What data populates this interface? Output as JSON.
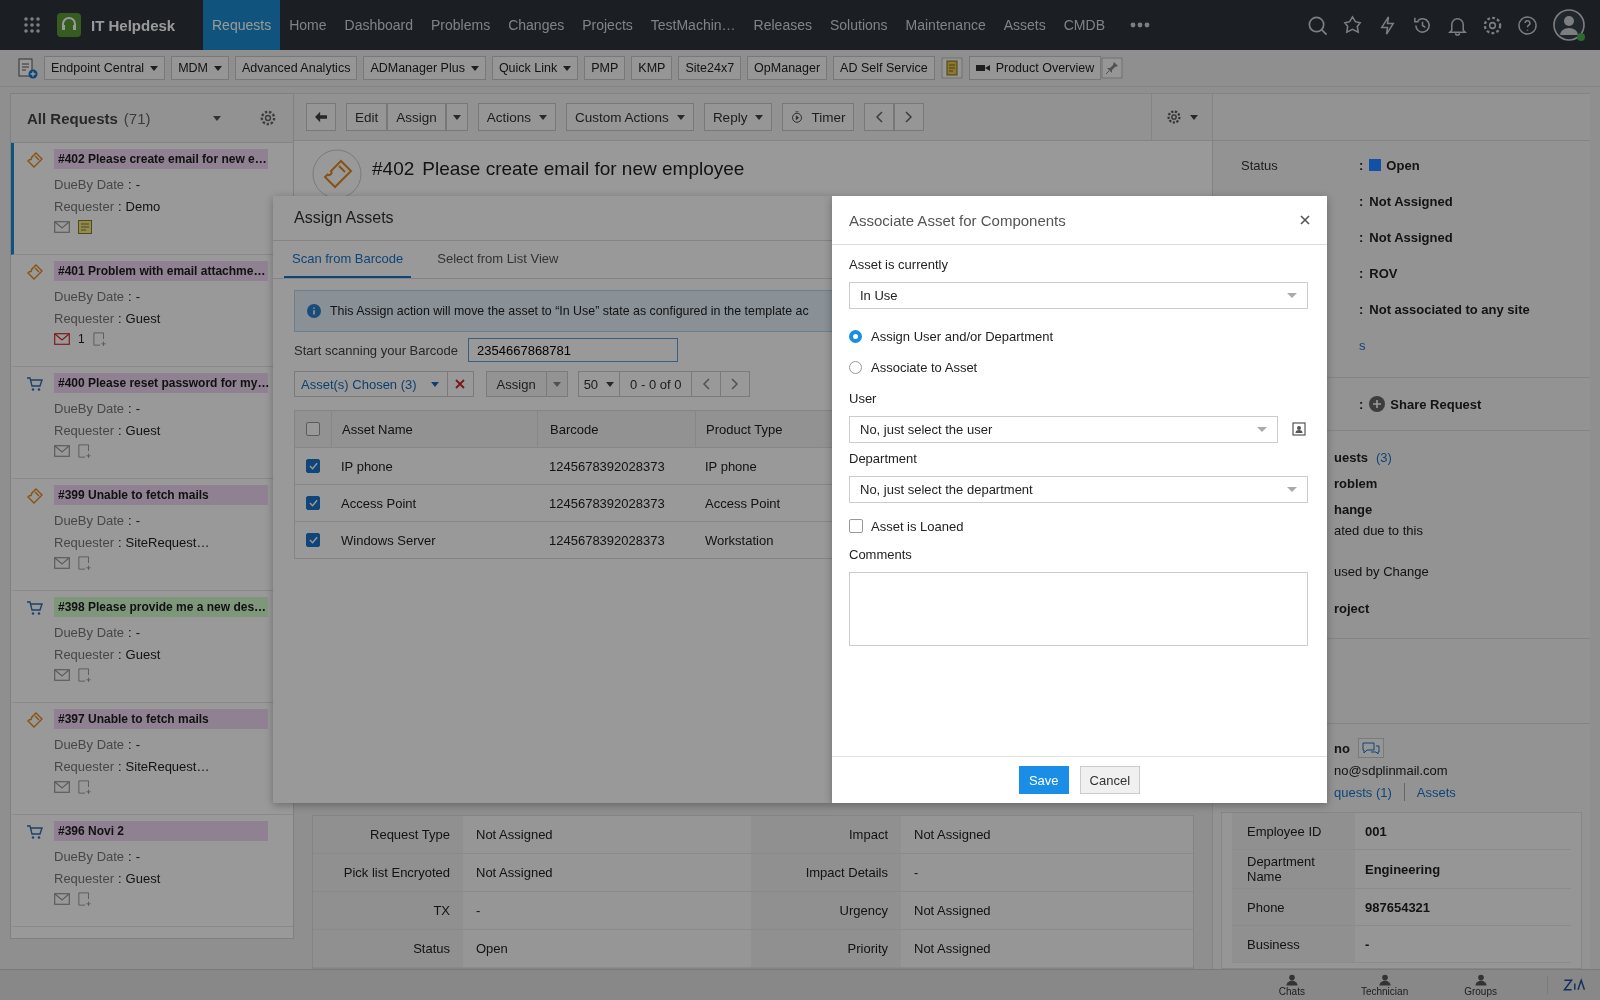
{
  "app": {
    "title": "IT Helpdesk"
  },
  "nav": [
    {
      "label": "Requests",
      "selected": true
    },
    {
      "label": "Home",
      "selected": false
    },
    {
      "label": "Dashboard",
      "selected": false
    },
    {
      "label": "Problems",
      "selected": false
    },
    {
      "label": "Changes",
      "selected": false
    },
    {
      "label": "Projects",
      "selected": false
    },
    {
      "label": "TestMachin…",
      "selected": false
    },
    {
      "label": "Releases",
      "selected": false
    },
    {
      "label": "Solutions",
      "selected": false
    },
    {
      "label": "Maintenance",
      "selected": false
    },
    {
      "label": "Assets",
      "selected": false
    },
    {
      "label": "CMDB",
      "selected": false
    }
  ],
  "quick_links": [
    {
      "label": "Endpoint Central",
      "dropdown": true
    },
    {
      "label": "MDM",
      "dropdown": true
    },
    {
      "label": "Advanced Analytics",
      "dropdown": false
    },
    {
      "label": "ADManager Plus",
      "dropdown": true
    },
    {
      "label": "Quick Link",
      "dropdown": true
    },
    {
      "label": "PMP",
      "dropdown": false
    },
    {
      "label": "KMP",
      "dropdown": false
    },
    {
      "label": "Site24x7",
      "dropdown": false
    },
    {
      "label": "OpManager",
      "dropdown": false
    },
    {
      "label": "AD Self Service",
      "dropdown": false
    }
  ],
  "product_overview": "Product Overview",
  "request_list": {
    "title": "All Requests",
    "count": "(71)",
    "separator": ":",
    "items": [
      {
        "kind": "incident",
        "title": "#402 Please create email for new e…",
        "color": "#8f8092",
        "selected": true,
        "dueby_label": "DueBy Date",
        "dueby": "-",
        "requester_label": "Requester",
        "requester": "Demo",
        "mail_unread": false,
        "note": true
      },
      {
        "kind": "incident",
        "title": "#401 Problem with email attachme…",
        "color": "#8f8092",
        "selected": false,
        "dueby_label": "DueBy Date",
        "dueby": "-",
        "requester_label": "Requester",
        "requester": "Guest",
        "mail_unread": true,
        "mail_count": "1",
        "note": false
      },
      {
        "kind": "service",
        "title": "#400 Please reset password for my…",
        "color": "#8f8092",
        "selected": false,
        "dueby_label": "DueBy Date",
        "dueby": "-",
        "requester_label": "Requester",
        "requester": "Guest",
        "mail_unread": false,
        "note": false
      },
      {
        "kind": "incident",
        "title": "#399 Unable to fetch mails",
        "color": "#8f8092",
        "selected": false,
        "dueby_label": "DueBy Date",
        "dueby": "-",
        "requester_label": "Requester",
        "requester": "SiteRequest…",
        "mail_unread": false,
        "note": false
      },
      {
        "kind": "service",
        "title": "#398 Please provide me a new des…",
        "color": "#7e977b",
        "selected": false,
        "dueby_label": "DueBy Date",
        "dueby": "-",
        "requester_label": "Requester",
        "requester": "Guest",
        "mail_unread": false,
        "note": false
      },
      {
        "kind": "incident",
        "title": "#397 Unable to fetch mails",
        "color": "#8f8092",
        "selected": false,
        "dueby_label": "DueBy Date",
        "dueby": "-",
        "requester_label": "Requester",
        "requester": "SiteRequest…",
        "mail_unread": false,
        "note": false
      },
      {
        "kind": "service",
        "title": "#396 Novi 2",
        "color": "#8f8092",
        "selected": false,
        "dueby_label": "DueBy Date",
        "dueby": "-",
        "requester_label": "Requester",
        "requester": "Guest",
        "mail_unread": false,
        "note": false
      }
    ]
  },
  "detail_toolbar": [
    {
      "label": "Edit",
      "kind": "plain"
    },
    {
      "label": "Assign",
      "kind": "split"
    },
    {
      "label": "Actions",
      "kind": "menu"
    },
    {
      "label": "Custom Actions",
      "kind": "menu"
    },
    {
      "label": "Reply",
      "kind": "menu"
    },
    {
      "label": "Timer",
      "kind": "timer"
    }
  ],
  "request": {
    "id": "#402",
    "title": "Please create email for new employee"
  },
  "details": [
    {
      "label": "Request Type",
      "value": "Not Assigned",
      "label_2": "Impact",
      "value_2": "Not Assigned"
    },
    {
      "label": "Pick list Encryoted",
      "value": "Not Assigned",
      "label_2": "Impact Details",
      "value_2": "-"
    },
    {
      "label": "TX",
      "value": "-",
      "label_2": "Urgency",
      "value_2": "Not Assigned"
    },
    {
      "label": "Status",
      "value": "Open",
      "label_2": "Priority",
      "value_2": "Not Assigned"
    }
  ],
  "properties": {
    "separator": ":",
    "status": {
      "label": "Status",
      "text": "Open",
      "color": "#1450aa"
    },
    "values": [
      "Not Assigned",
      "Not Assigned",
      "ROV",
      "Not associated to any site"
    ],
    "more_link": "s",
    "share": "Share Request"
  },
  "related": {
    "title": "uests",
    "count": "(3)",
    "lines": [
      {
        "text": "roblem",
        "bold": true
      },
      {
        "text": "hange",
        "bold": true
      },
      {
        "text": "ated due to this",
        "bold": false
      },
      {
        "text": "used by Change",
        "bold": false
      },
      {
        "text": "roject",
        "bold": true
      }
    ]
  },
  "requester": {
    "name": "no",
    "email": "no@sdplinmail.com",
    "links": [
      "quests (1)",
      "Assets"
    ],
    "fields": [
      {
        "label": "Employee ID",
        "value": "001"
      },
      {
        "label": "Department Name",
        "value": "Engineering"
      },
      {
        "label": "Phone",
        "value": "987654321"
      },
      {
        "label": "Business",
        "value": "-"
      }
    ]
  },
  "assign_dialog": {
    "title": "Assign Assets",
    "tabs": [
      {
        "label": "Scan from Barcode",
        "selected": true
      },
      {
        "label": "Select from List View",
        "selected": false
      }
    ],
    "info": "This Assign action will move the asset to “In Use” state as configured in the template ac",
    "barcode_label": "Start scanning your Barcode",
    "barcode": "2354667868781",
    "chosen": "Asset(s) Chosen (3)",
    "assign": "Assign",
    "page_size": "50",
    "range": "0 - 0 of 0",
    "select_all_checked": false,
    "columns": [
      "Asset Name",
      "Barcode",
      "Product Type"
    ],
    "rows": [
      {
        "checked": true,
        "cells": [
          "IP phone",
          "1245678392028373",
          "IP phone"
        ]
      },
      {
        "checked": true,
        "cells": [
          "Access Point",
          "1245678392028373",
          "Access Point"
        ]
      },
      {
        "checked": true,
        "cells": [
          "Windows Server",
          "1245678392028373",
          "Workstation"
        ]
      }
    ]
  },
  "associate_dialog": {
    "title": "Associate Asset for Components",
    "state_label": "Asset is currently",
    "state": "In Use",
    "options": [
      {
        "label": "Assign User and/or Department",
        "selected": true
      },
      {
        "label": "Associate to Asset",
        "selected": false
      }
    ],
    "user_label": "User",
    "user": "No, just select the user",
    "department_label": "Department",
    "department": "No, just select the department",
    "loaned": {
      "label": "Asset is Loaned",
      "checked": false
    },
    "comments_label": "Comments",
    "buttons": [
      {
        "label": "Save",
        "kind": "primary"
      },
      {
        "label": "Cancel",
        "kind": "secondary"
      }
    ]
  },
  "bottom_bar": [
    "Chats",
    "Technician",
    "Groups"
  ]
}
